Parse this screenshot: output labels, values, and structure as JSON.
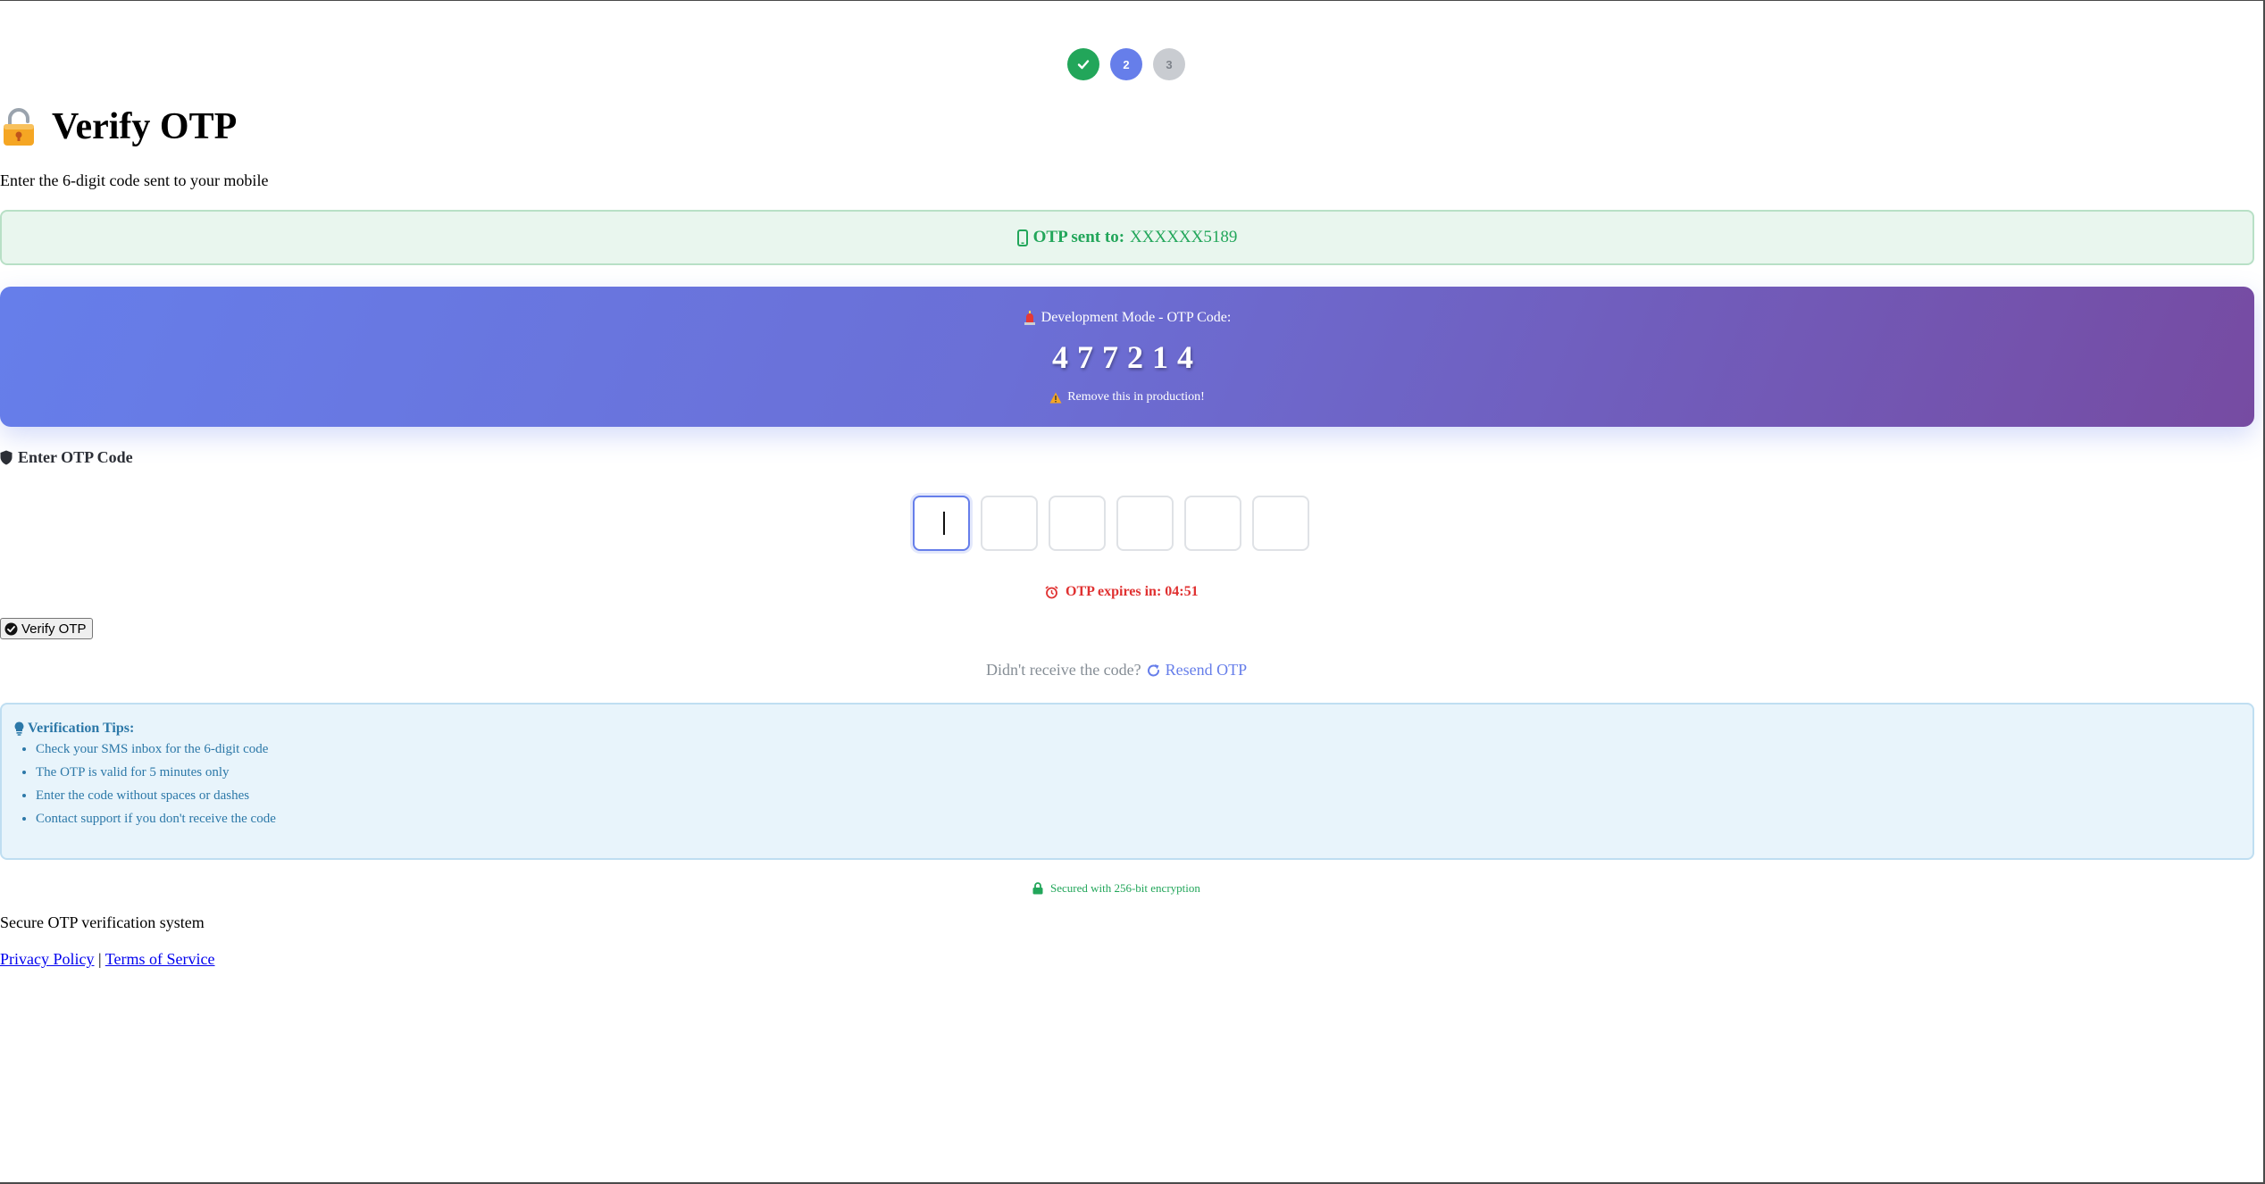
{
  "stepper": {
    "steps": [
      {
        "label": "",
        "state": "done"
      },
      {
        "label": "2",
        "state": "active"
      },
      {
        "label": "3",
        "state": "pending"
      }
    ]
  },
  "header": {
    "title": "Verify OTP",
    "subtitle": "Enter the 6-digit code sent to your mobile"
  },
  "sent": {
    "label": "OTP sent to:",
    "number": "XXXXXX5189"
  },
  "dev": {
    "heading": "Development Mode - OTP Code:",
    "code": "477214",
    "warning": "Remove this in production!"
  },
  "otp": {
    "label": "Enter OTP Code",
    "digits": [
      "",
      "",
      "",
      "",
      "",
      ""
    ],
    "expiry_label": "OTP expires in: 04:51",
    "verify_label": "Verify OTP"
  },
  "resend": {
    "prompt": "Didn't receive the code?",
    "link": "Resend OTP"
  },
  "tips": {
    "title": "Verification Tips:",
    "items": [
      "Check your SMS inbox for the 6-digit code",
      "The OTP is valid for 5 minutes only",
      "Enter the code without spaces or dashes",
      "Contact support if you don't receive the code"
    ]
  },
  "security_note": "Secured with 256-bit encryption",
  "footer": {
    "text": "Secure OTP verification system",
    "privacy": "Privacy Policy",
    "separator": "|",
    "terms": "Terms of Service"
  },
  "colors": {
    "success": "#22a65a",
    "primary": "#667eea",
    "secondary": "#764ba2",
    "danger": "#e03131",
    "info": "#2c78a8"
  }
}
